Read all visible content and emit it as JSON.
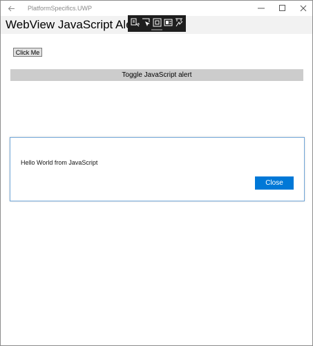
{
  "window": {
    "app_title": "PlatformSpecifics.UWP"
  },
  "page": {
    "title": "WebView JavaScript Alert"
  },
  "debug_toolbar": {
    "icons": [
      "live-visual-tree-icon",
      "select-element-icon",
      "display-layout-adorners-icon",
      "track-focus-icon",
      "hot-reload-icon"
    ]
  },
  "content": {
    "click_me_label": "Click Me",
    "toggle_label": "Toggle JavaScript alert"
  },
  "dialog": {
    "message": "Hello World from JavaScript",
    "close_label": "Close",
    "accent_color": "#0078d7"
  }
}
